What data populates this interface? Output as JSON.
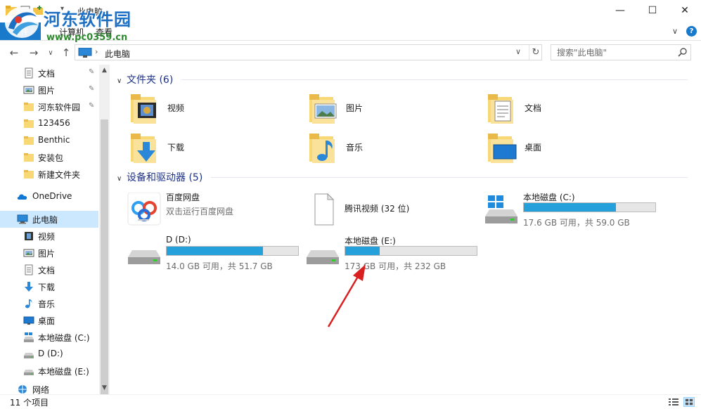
{
  "window": {
    "title": "此电脑",
    "minimize_glyph": "—",
    "maximize_glyph": "☐",
    "close_glyph": "✕"
  },
  "watermark": {
    "title": "河东软件园",
    "url": "www.pc0359.cn"
  },
  "ribbon": {
    "file_tab": "文件",
    "tabs": [
      "计算机",
      "查看"
    ],
    "expand_glyph": "∨",
    "help_glyph": "?"
  },
  "nav": {
    "back_glyph": "←",
    "forward_glyph": "→",
    "recent_glyph": "∨",
    "up_glyph": "↑"
  },
  "address": {
    "location": "此电脑",
    "separator": "›",
    "dropdown_glyph": "∨",
    "refresh_glyph": "↻"
  },
  "search": {
    "placeholder": "搜索\"此电脑\""
  },
  "sidebar": {
    "quick_access": [
      {
        "label": "文档",
        "icon": "document-icon",
        "pinned": true
      },
      {
        "label": "图片",
        "icon": "pictures-icon",
        "pinned": true
      },
      {
        "label": "河东软件园",
        "icon": "folder-icon",
        "pinned": true
      },
      {
        "label": "123456",
        "icon": "folder-icon",
        "pinned": false
      },
      {
        "label": "Benthic",
        "icon": "folder-icon",
        "pinned": false
      },
      {
        "label": "安装包",
        "icon": "folder-icon",
        "pinned": false
      },
      {
        "label": "新建文件夹",
        "icon": "folder-icon",
        "pinned": false
      }
    ],
    "onedrive": "OneDrive",
    "this_pc": "此电脑",
    "pc_children": [
      {
        "label": "视频",
        "icon": "videos-icon"
      },
      {
        "label": "图片",
        "icon": "pictures-icon"
      },
      {
        "label": "文档",
        "icon": "document-icon"
      },
      {
        "label": "下载",
        "icon": "download-icon"
      },
      {
        "label": "音乐",
        "icon": "music-icon"
      },
      {
        "label": "桌面",
        "icon": "desktop-icon"
      },
      {
        "label": "本地磁盘 (C:)",
        "icon": "system-drive-icon"
      },
      {
        "label": "D (D:)",
        "icon": "drive-icon"
      },
      {
        "label": "本地磁盘 (E:)",
        "icon": "drive-icon"
      }
    ],
    "network": "网络"
  },
  "folders_group": {
    "title": "文件夹 (6)",
    "items": [
      {
        "label": "视频",
        "icon": "videos-folder-icon"
      },
      {
        "label": "图片",
        "icon": "pictures-folder-icon"
      },
      {
        "label": "文档",
        "icon": "documents-folder-icon"
      },
      {
        "label": "下载",
        "icon": "downloads-folder-icon"
      },
      {
        "label": "音乐",
        "icon": "music-folder-icon"
      },
      {
        "label": "桌面",
        "icon": "desktop-folder-icon"
      }
    ]
  },
  "devices_group": {
    "title": "设备和驱动器 (5)",
    "items": [
      {
        "name": "百度网盘",
        "sub": "双击运行百度网盘",
        "icon": "baidu-netdisk-icon"
      },
      {
        "name": "腾讯视频 (32 位)",
        "icon": "tencent-video-icon"
      },
      {
        "name": "本地磁盘 (C:)",
        "free": "17.6 GB 可用，共 59.0 GB",
        "used_fraction": 0.7,
        "icon": "system-drive-icon"
      },
      {
        "name": "D (D:)",
        "free": "14.0 GB 可用，共 51.7 GB",
        "used_fraction": 0.73,
        "icon": "drive-icon"
      },
      {
        "name": "本地磁盘 (E:)",
        "free": "173 GB 可用，共 232 GB",
        "used_fraction": 0.26,
        "icon": "drive-icon"
      }
    ]
  },
  "statusbar": {
    "count": "11 个项目"
  },
  "colors": {
    "accent": "#1979ca",
    "selection": "#cce8ff",
    "bar_fill": "#26a0da",
    "annotation_arrow": "#d92020"
  }
}
